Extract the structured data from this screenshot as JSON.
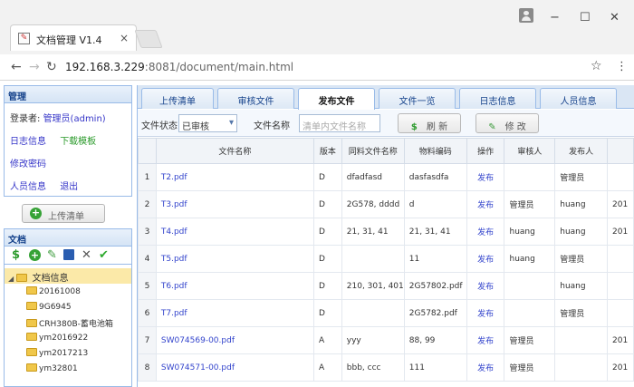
{
  "browser": {
    "tab_title": "文档管理 V1.4",
    "tab_close": "×",
    "address_host": "192.168.3.229",
    "address_rest": ":8081/document/main.html",
    "win_minimize": "−",
    "win_maximize": "☐",
    "win_close": "✕"
  },
  "sidebar": {
    "manage_title": "管理",
    "login_label": "登录者:",
    "login_user": "管理员(admin)",
    "log_info": "日志信息",
    "download_template": "下载模板",
    "change_password": "修改密码",
    "user_info": "人员信息",
    "logout": "退出",
    "upload_list": "上传清单",
    "docs_title": "文档",
    "tree_root": "文档信息",
    "tree_items": [
      "20161008",
      "9G6945",
      "CRH380B-蓄电池箱",
      "ym2016922",
      "ym2017213",
      "ym32801"
    ]
  },
  "tabs": [
    "上传清单",
    "审核文件",
    "发布文件",
    "文件一览",
    "日志信息",
    "人员信息"
  ],
  "active_tab": "发布文件",
  "filter": {
    "status_label": "文件状态",
    "status_value": "已审核",
    "name_label": "文件名称",
    "name_placeholder": "清单内文件名称",
    "refresh_label": "刷  新",
    "edit_label": "修  改"
  },
  "table": {
    "headers": [
      "",
      "文件名称",
      "版本",
      "同料文件名称",
      "物料编码",
      "操作",
      "审核人",
      "发布人",
      ""
    ],
    "rows": [
      [
        "1",
        "T2.pdf",
        "D",
        "dfadfasd",
        "dasfasdfa",
        "发布",
        "",
        "管理员",
        ""
      ],
      [
        "2",
        "T3.pdf",
        "D",
        "2G578, dddd",
        "d",
        "发布",
        "管理员",
        "huang",
        "201"
      ],
      [
        "3",
        "T4.pdf",
        "D",
        "21, 31, 41",
        "21, 31, 41",
        "发布",
        "huang",
        "huang",
        "201"
      ],
      [
        "4",
        "T5.pdf",
        "D",
        "",
        "11",
        "发布",
        "huang",
        "管理员",
        ""
      ],
      [
        "5",
        "T6.pdf",
        "D",
        "210, 301, 401",
        "2G57802.pdf",
        "发布",
        "",
        "huang",
        ""
      ],
      [
        "6",
        "T7.pdf",
        "D",
        "",
        "2G5782.pdf",
        "发布",
        "",
        "管理员",
        ""
      ],
      [
        "7",
        "SW074569-00.pdf",
        "A",
        "yyy",
        "88, 99",
        "发布",
        "管理员",
        "",
        "201"
      ],
      [
        "8",
        "SW074571-00.pdf",
        "A",
        "bbb, ccc",
        "111",
        "发布",
        "管理员",
        "",
        "201"
      ]
    ]
  },
  "colors": {
    "accent_border": "#99bbe8",
    "link_blue": "#3344cc",
    "tree_selected": "#fbe9a8"
  }
}
